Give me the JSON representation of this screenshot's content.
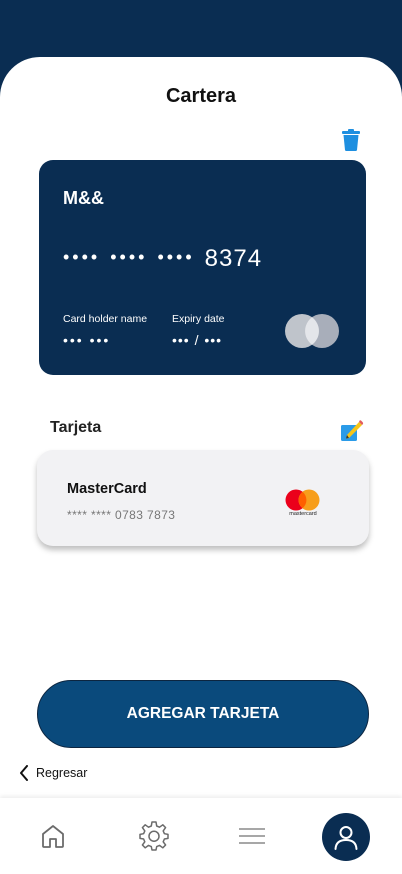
{
  "header": {
    "title": "Cartera"
  },
  "bank_card": {
    "bank_name": "M&&",
    "masked_groups": [
      "••••",
      "••••",
      "••••"
    ],
    "last_digits": "8374",
    "holder_label": "Card holder name",
    "holder_value": "••• •••",
    "expiry_label": "Expiry date",
    "expiry_value": "••• / •••"
  },
  "section": {
    "title": "Tarjeta"
  },
  "saved_card": {
    "brand": "MasterCard",
    "number": "**** **** 0783 7873",
    "logo_text": "mastercard"
  },
  "actions": {
    "add_card_label": "AGREGAR TARJETA",
    "back_label": "Regresar"
  },
  "colors": {
    "primary": "#0a2d52",
    "button": "#0a4a7c",
    "trash": "#1e8fe0",
    "mc_red": "#eb001b",
    "mc_orange": "#f79e1b"
  },
  "bottom_nav": {
    "items": [
      "home-icon",
      "gear-icon",
      "menu-icon",
      "user-icon"
    ],
    "active": "user-icon"
  }
}
